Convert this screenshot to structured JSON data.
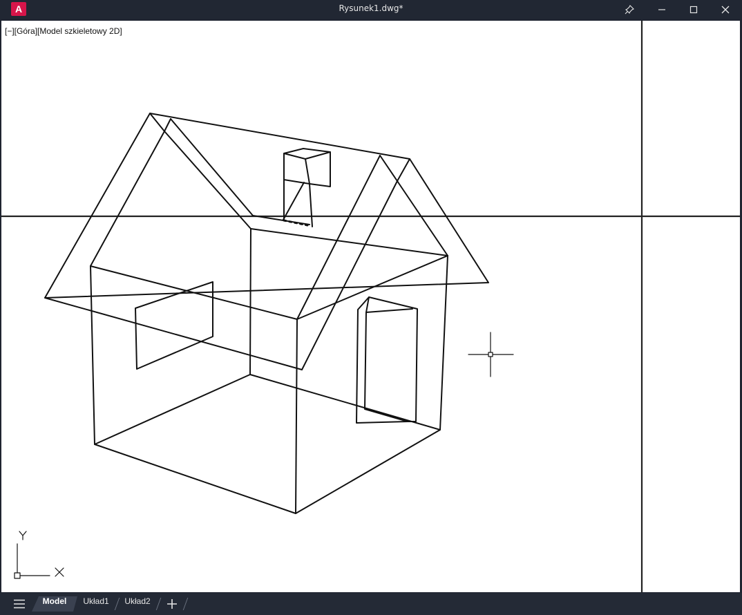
{
  "window": {
    "title": "Rysunek1.dwg*",
    "app_icon": "A"
  },
  "titlebar_buttons": [
    "pin-icon",
    "minimize-icon",
    "maximize-icon",
    "close-icon"
  ],
  "viewport": {
    "label": "[−][Góra][Model szkieletowy 2D]",
    "ucs_y": "Y",
    "ucs_x": "X"
  },
  "tabs": {
    "menu_icon": "hamburger-icon",
    "model": "Model",
    "layout1": "Układ1",
    "layout2": "Układ2",
    "add_icon": "plus-icon"
  },
  "colors": {
    "titlebar": "#212733",
    "accent": "#d6154a",
    "canvas": "#ffffff",
    "lines": "#111111"
  }
}
